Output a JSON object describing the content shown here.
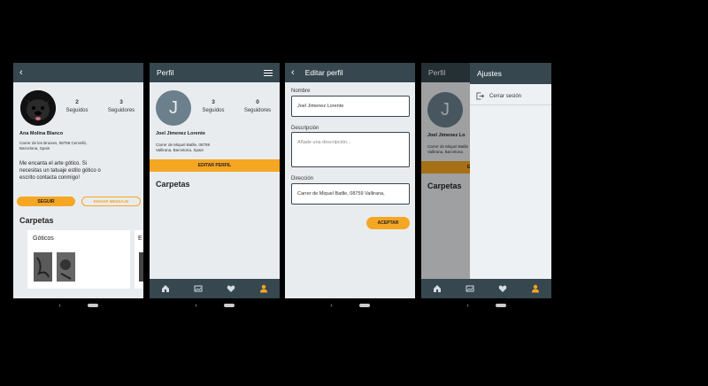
{
  "screen1": {
    "user_name": "Ana Molina Blanco",
    "address": "Carrer de les Bruixes, 08758 Cervelló, Barcelona, Spain",
    "following_count": "2",
    "following_label": "Seguidos",
    "followers_count": "3",
    "followers_label": "Seguidores",
    "bio": "Me encanta el arte gótico. Si necesitas un tatuaje estilo gótico o escrito contacta conmigo!",
    "follow_button": "SEGUIR",
    "message_button": "ENVIAR MENSAJE",
    "folders_title": "Carpetas",
    "folder1_title": "Góticos",
    "folder2_title_partial": "E"
  },
  "screen2": {
    "title": "Perfil",
    "avatar_letter": "J",
    "user_name": "Joel Jimenez Lorente",
    "address": "Carrer de Miquel Batlle, 08759 Vallirana, Barcelona, Spain",
    "following_count": "3",
    "following_label": "Seguidos",
    "followers_count": "0",
    "followers_label": "Seguidores",
    "edit_button": "EDITAR PERFIL",
    "folders_title": "Carpetas"
  },
  "screen3": {
    "title": "Editar perfil",
    "name_label": "Nombre",
    "name_value": "Joel Jimenez Lorente",
    "description_label": "Descripción",
    "description_placeholder": "Añade una descripción...",
    "address_label": "Dirección",
    "address_value": "Carrer de Miquel Batlle, 08759 Vallirana,",
    "accept_button": "ACEPTAR"
  },
  "screen4": {
    "title_behind": "Perfil",
    "drawer_title": "Ajustes",
    "logout_label": "Cerrar sesión",
    "avatar_letter": "J",
    "user_name_partial": "Joel Jimenez Lo",
    "address_partial": "Carrer de Miquel Batlle Vallirana, Barcelona",
    "edit_partial": "E",
    "folders_title": "Carpetas"
  },
  "colors": {
    "appbar": "#37474f",
    "accent": "#f5a623",
    "background": "#e9ecef"
  },
  "icons": {
    "nav": [
      "home-icon",
      "gallery-icon",
      "heart-icon",
      "person-icon"
    ]
  }
}
